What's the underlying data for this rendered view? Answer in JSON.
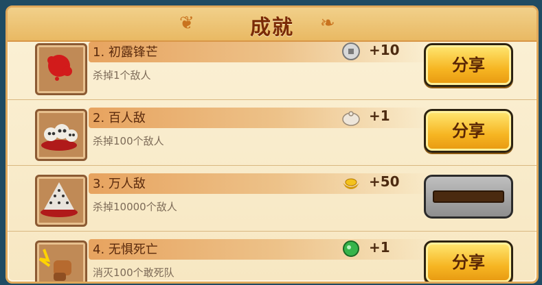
{
  "header": {
    "title": "成就"
  },
  "achievements": [
    {
      "name": "1. 初露锋芒",
      "desc": "杀掉1个敌人",
      "reward_icon": "coin-icon",
      "reward": "+10",
      "action": "分享"
    },
    {
      "name": "2. 百人敌",
      "desc": "杀掉100个敌人",
      "reward_icon": "bun-icon",
      "reward": "+1",
      "action": "分享"
    },
    {
      "name": "3. 万人敌",
      "desc": "杀掉10000个敌人",
      "reward_icon": "gold-ingot-icon",
      "reward": "+50",
      "progress": 0
    },
    {
      "name": "4. 无惧死亡",
      "desc": "消灭100个敢死队",
      "reward_icon": "jade-icon",
      "reward": "+1",
      "action": "分享"
    }
  ]
}
